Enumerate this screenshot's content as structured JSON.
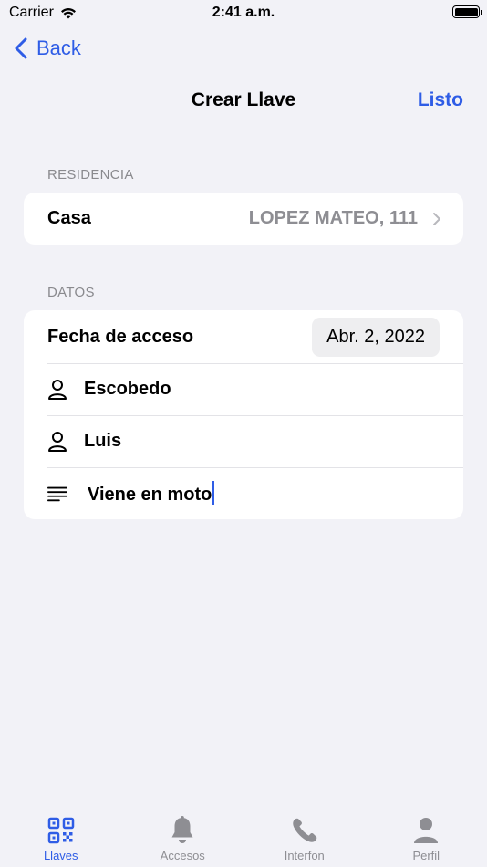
{
  "status_bar": {
    "carrier": "Carrier",
    "time": "2:41 a.m."
  },
  "nav": {
    "back_label": "Back",
    "title": "Crear Llave",
    "done_label": "Listo"
  },
  "residencia": {
    "header": "RESIDENCIA",
    "label": "Casa",
    "value": "LOPEZ MATEO, 111"
  },
  "datos": {
    "header": "DATOS",
    "date_label": "Fecha de acceso",
    "date_value": "Abr. 2, 2022",
    "last_name": "Escobedo",
    "first_name": "Luis",
    "note": "Viene en moto"
  },
  "tabs": [
    {
      "label": "Llaves",
      "icon": "qr-code-icon",
      "active": true
    },
    {
      "label": "Accesos",
      "icon": "bell-icon",
      "active": false
    },
    {
      "label": "Interfon",
      "icon": "phone-icon",
      "active": false
    },
    {
      "label": "Perfil",
      "icon": "person-icon",
      "active": false
    }
  ],
  "colors": {
    "accent": "#2f5de6",
    "background": "#f2f2f7",
    "secondary_text": "#8e8e93"
  }
}
